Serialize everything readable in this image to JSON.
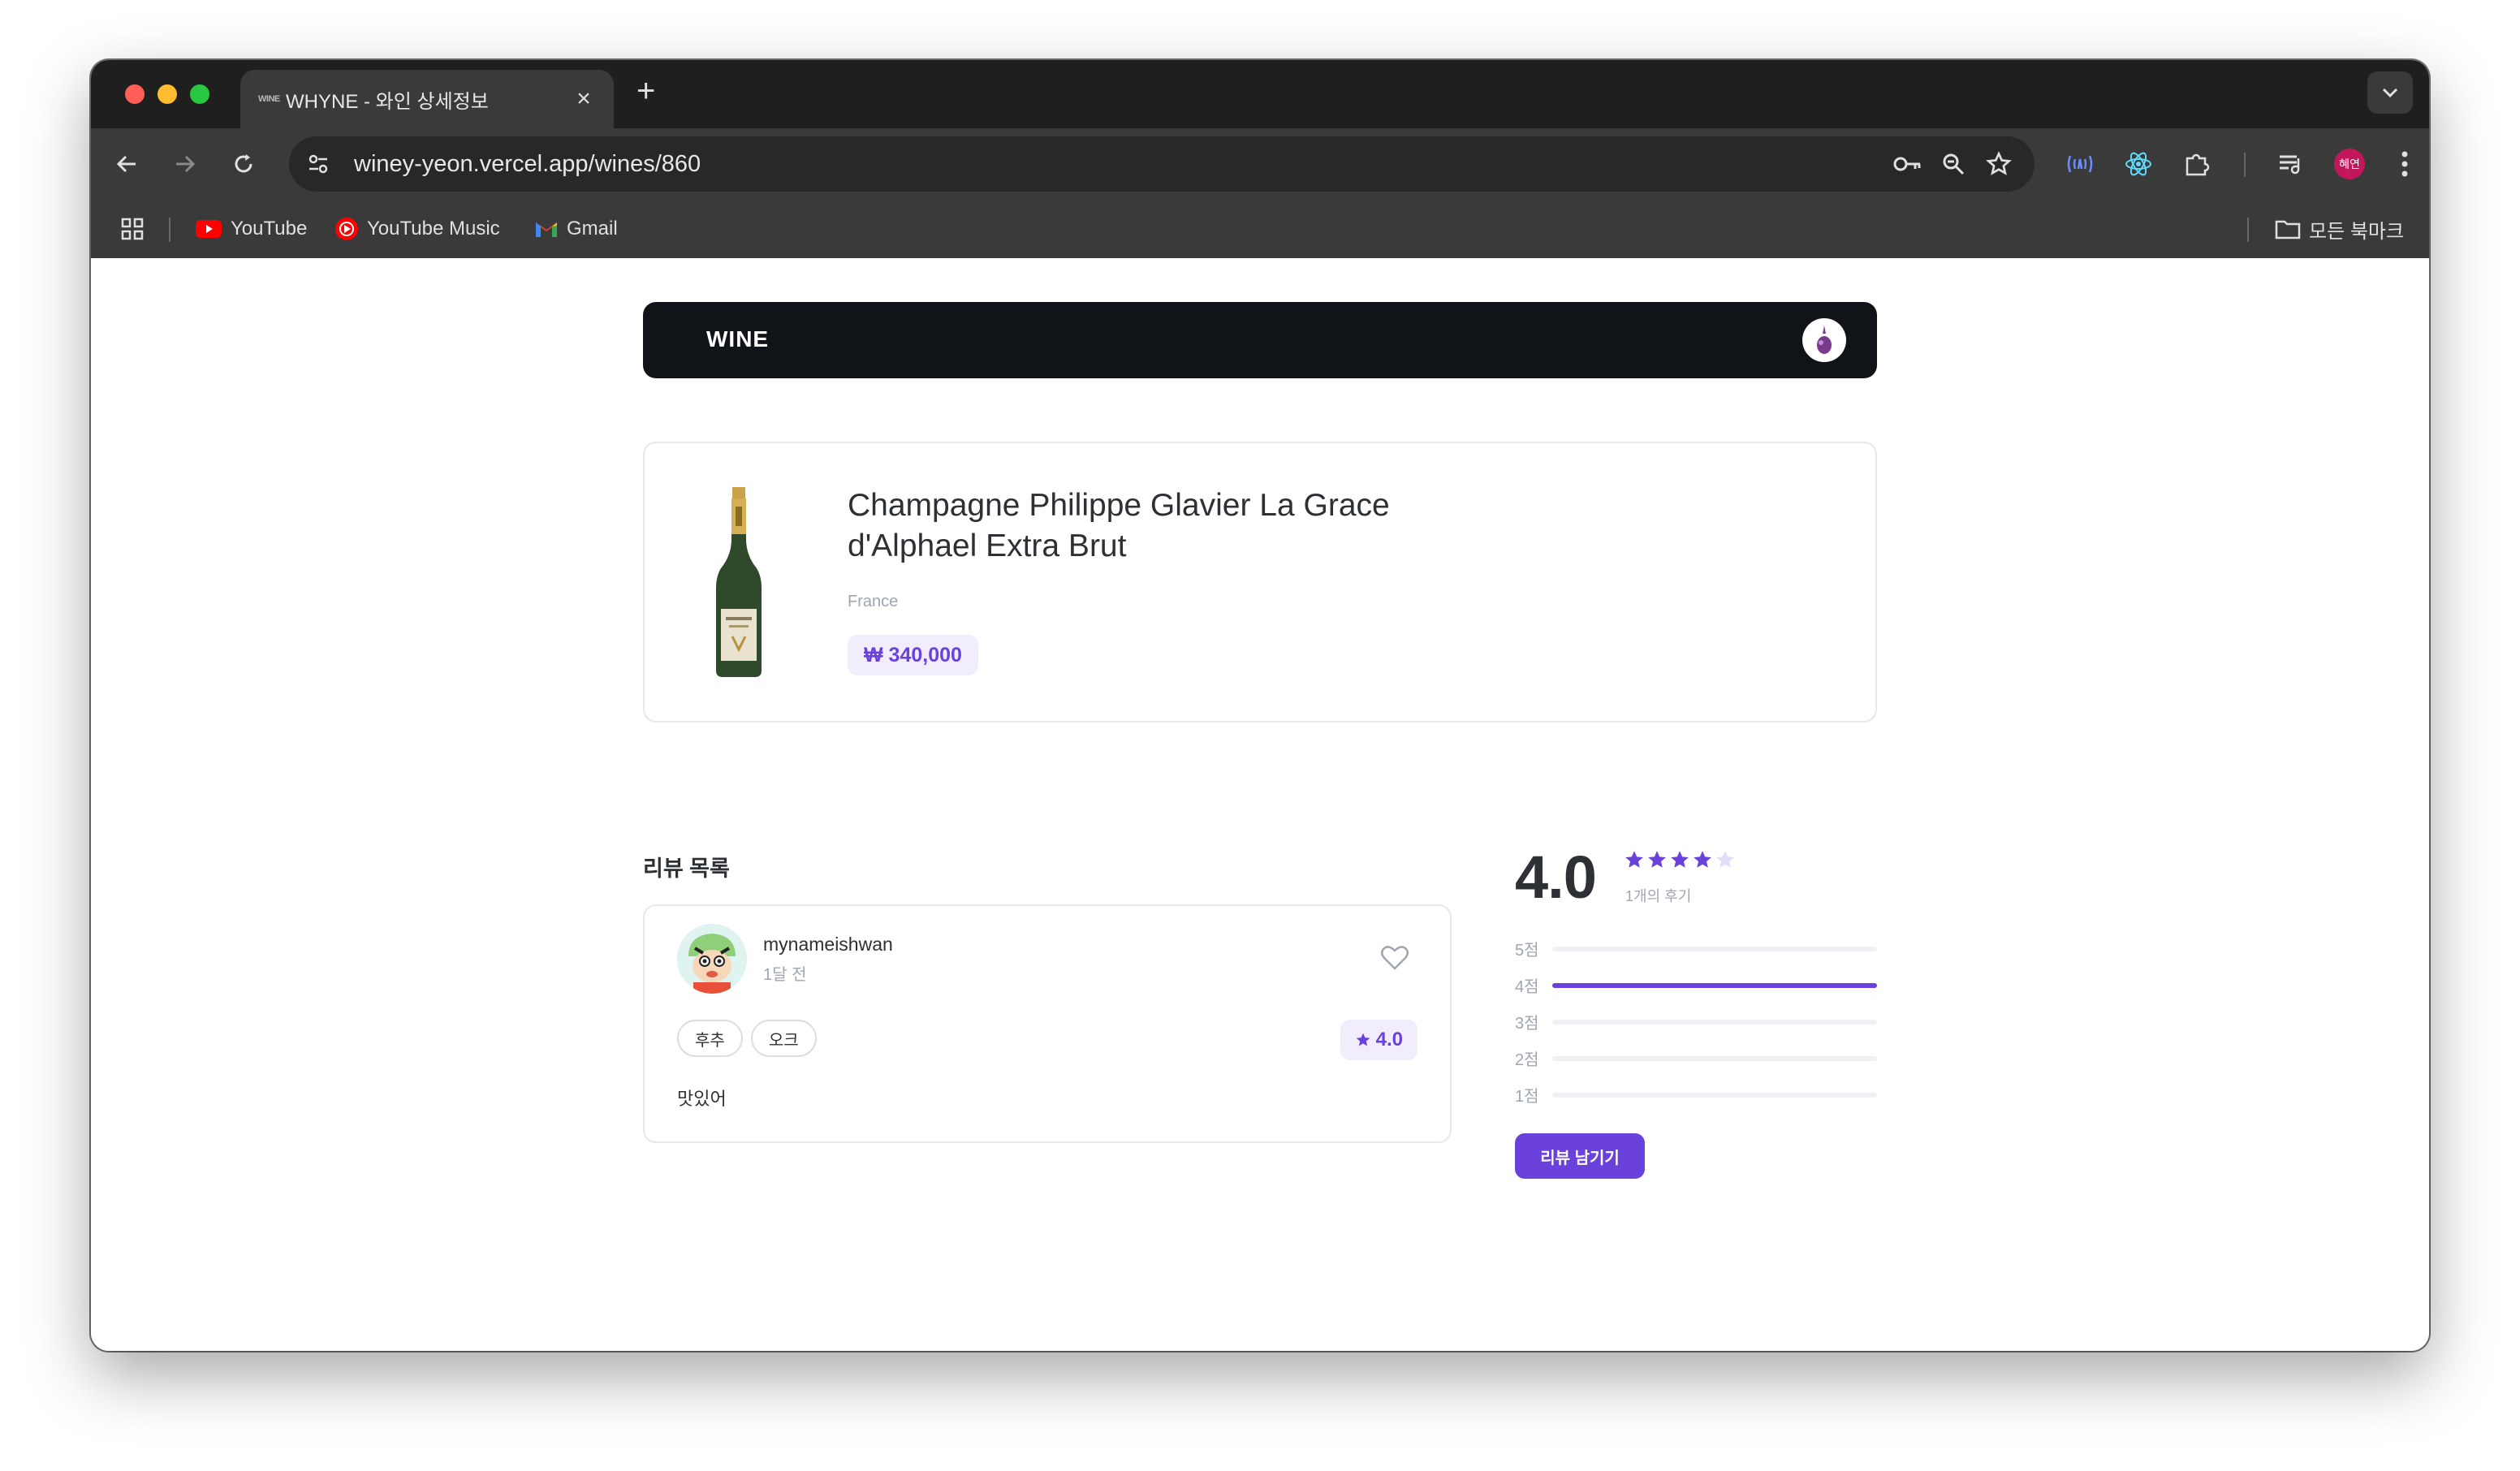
{
  "browser": {
    "tab_title": "WHYNE - 와인 상세정보",
    "tab_favicon_text": "WINE",
    "url": "winey-yeon.vercel.app/wines/860",
    "profile_initials": "혜연",
    "bookmarks": [
      {
        "label": "YouTube",
        "icon": "youtube-icon"
      },
      {
        "label": "YouTube Music",
        "icon": "youtube-music-icon"
      },
      {
        "label": "Gmail",
        "icon": "gmail-icon"
      }
    ],
    "all_bookmarks_label": "모든 북마크"
  },
  "site": {
    "logo": "WINE"
  },
  "wine": {
    "name": "Champagne Philippe Glavier La Grace d'Alphael Extra Brut",
    "region": "France",
    "price": "₩ 340,000"
  },
  "reviews": {
    "section_title": "리뷰 목록",
    "items": [
      {
        "user": "mynameishwan",
        "time": "1달 전",
        "tags": [
          "후추",
          "오크"
        ],
        "rating": "4.0",
        "text": "맛있어"
      }
    ]
  },
  "summary": {
    "average": "4.0",
    "stars_filled": 4,
    "stars_total": 5,
    "count_label": "1개의 후기",
    "distribution": [
      {
        "label": "5점",
        "fraction": 0
      },
      {
        "label": "4점",
        "fraction": 1
      },
      {
        "label": "3점",
        "fraction": 0
      },
      {
        "label": "2점",
        "fraction": 0
      },
      {
        "label": "1점",
        "fraction": 0
      }
    ],
    "write_review_label": "리뷰 남기기"
  },
  "colors": {
    "accent": "#6a42db",
    "header_bg": "#101318",
    "badge_bg": "#f1edfc"
  }
}
